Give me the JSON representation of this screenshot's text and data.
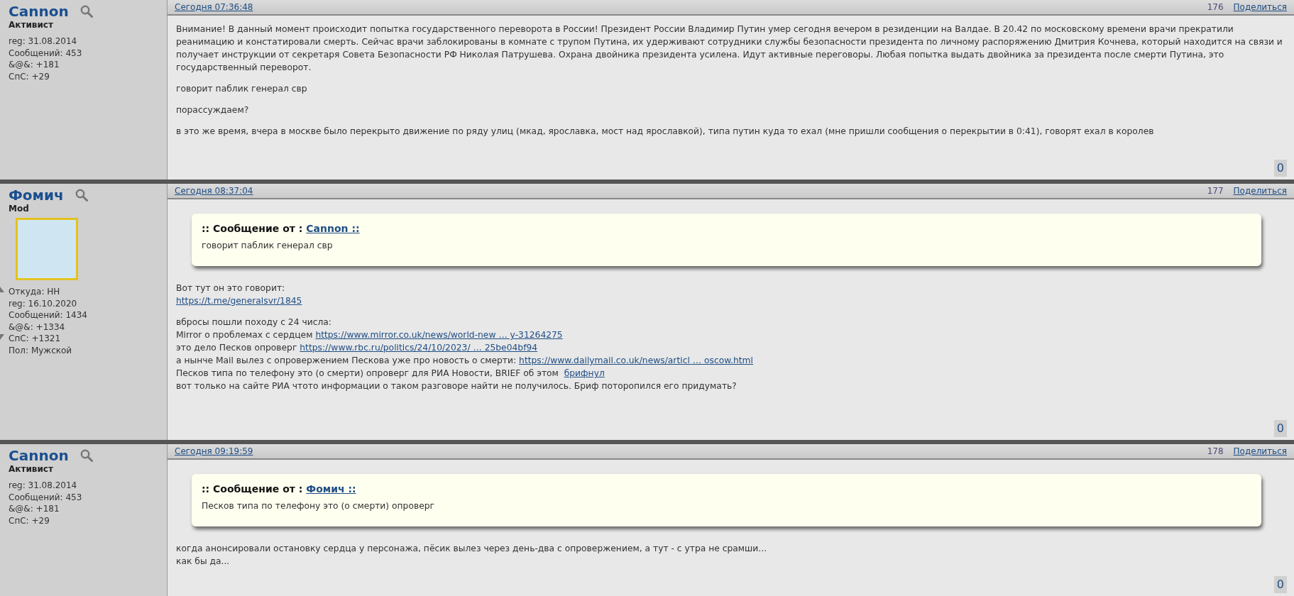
{
  "posts": [
    {
      "author": "Cannon",
      "role": "Активист",
      "avatar": false,
      "info": [
        "reg: 31.08.2014",
        "Сообщений: 453",
        "&@&: +181",
        "СпС: +29"
      ],
      "date": "Сегодня 07:36:48",
      "number": "176",
      "share": "Поделиться",
      "counter": "0",
      "blocks": [
        {
          "kind": "lines",
          "lines": [
            [
              {
                "kind": "text",
                "text": "Внимание! В данный момент происходит попытка государственного переворота в России! Президент России Владимир Путин умер сегодня вечером в резиденции на Валдае. В 20.42 по московскому времени врачи прекратили реанимацию и констатировали смерть. Сейчас врачи заблокированы в комнате с трупом Путина, их удерживают сотрудники службы безопасности президента по личному распоряжению Дмитрия Кочнева, который находится на связи и получает инструкции от секретаря Совета Безопасности РФ Николая Патрушева. Охрана двойника президента усилена. Идут активные переговоры. Любая попытка выдать двойника за президента после смерти Путина, это государственный переворот."
              }
            ]
          ]
        },
        {
          "kind": "lines",
          "lines": [
            [
              {
                "kind": "text",
                "text": "говорит паблик генерал свр"
              }
            ]
          ]
        },
        {
          "kind": "lines",
          "lines": [
            [
              {
                "kind": "text",
                "text": "порассуждаем?"
              }
            ]
          ]
        },
        {
          "kind": "lines",
          "lines": [
            [
              {
                "kind": "text",
                "text": "в это же время, вчера в москве было перекрыто движение по ряду улиц (мкад, ярославка, мост над ярославкой), типа путин куда то ехал (мне пришли сообщения о перекрытии в 0:41), говорят ехал в королев"
              }
            ]
          ]
        }
      ]
    },
    {
      "author": "Фомич",
      "role": "Mod",
      "avatar": true,
      "info": [
        "Откуда: НН",
        "reg: 16.10.2020",
        "Сообщений: 1434",
        "&@&: +1334",
        "СпС: +1321",
        "Пол: Мужской"
      ],
      "date": "Сегодня 08:37:04",
      "number": "177",
      "share": "Поделиться",
      "counter": "0",
      "blocks": [
        {
          "kind": "quote",
          "label": ":: Сообщение от : ",
          "author": "Cannon ::",
          "text": "говорит паблик генерал свр"
        },
        {
          "kind": "lines",
          "lines": [
            [
              {
                "kind": "text",
                "text": "Вот тут он это говорит:"
              }
            ],
            [
              {
                "kind": "link",
                "text": "https://t.me/generalsvr/1845"
              }
            ]
          ]
        },
        {
          "kind": "lines",
          "lines": [
            [
              {
                "kind": "text",
                "text": "вбросы пошли походу с 24 числа:"
              }
            ],
            [
              {
                "kind": "text",
                "text": "Mirror о проблемах с сердцем "
              },
              {
                "kind": "link",
                "text": "https://www.mirror.co.uk/news/world-new … y-31264275"
              }
            ],
            [
              {
                "kind": "text",
                "text": "это дело Песков опроверг "
              },
              {
                "kind": "link",
                "text": "https://www.rbc.ru/politics/24/10/2023/ … 25be04bf94"
              }
            ],
            [
              {
                "kind": "text",
                "text": "а нынче Mail вылез с опровержением Пескова уже про новость о смерти: "
              },
              {
                "kind": "link",
                "text": "https://www.dailymail.co.uk/news/articl … oscow.html"
              }
            ],
            [
              {
                "kind": "text",
                "text": "Песков типа по телефону это (о смерти) опроверг для РИА Новости, BRIEF об этом  "
              },
              {
                "kind": "link",
                "text": "брифнул"
              }
            ],
            [
              {
                "kind": "text",
                "text": "вот только на сайте РИА чтото информации о таком разговоре найти не получилось. Бриф поторопился его придумать?"
              }
            ]
          ]
        }
      ]
    },
    {
      "author": "Cannon",
      "role": "Активист",
      "avatar": false,
      "info": [
        "reg: 31.08.2014",
        "Сообщений: 453",
        "&@&: +181",
        "СпС: +29"
      ],
      "date": "Сегодня 09:19:59",
      "number": "178",
      "share": "Поделиться",
      "counter": "0",
      "blocks": [
        {
          "kind": "quote",
          "label": ":: Сообщение от : ",
          "author": "Фомич ::",
          "text": "Песков типа по телефону это (о смерти) опроверг"
        },
        {
          "kind": "lines",
          "lines": [
            [
              {
                "kind": "text",
                "text": "когда анонсировали остановку сердца у персонажа, пёсик вылез через день-два с опровержением, а тут - с утра не срамши..."
              }
            ],
            [
              {
                "kind": "text",
                "text": "как бы да..."
              }
            ]
          ]
        }
      ]
    }
  ]
}
